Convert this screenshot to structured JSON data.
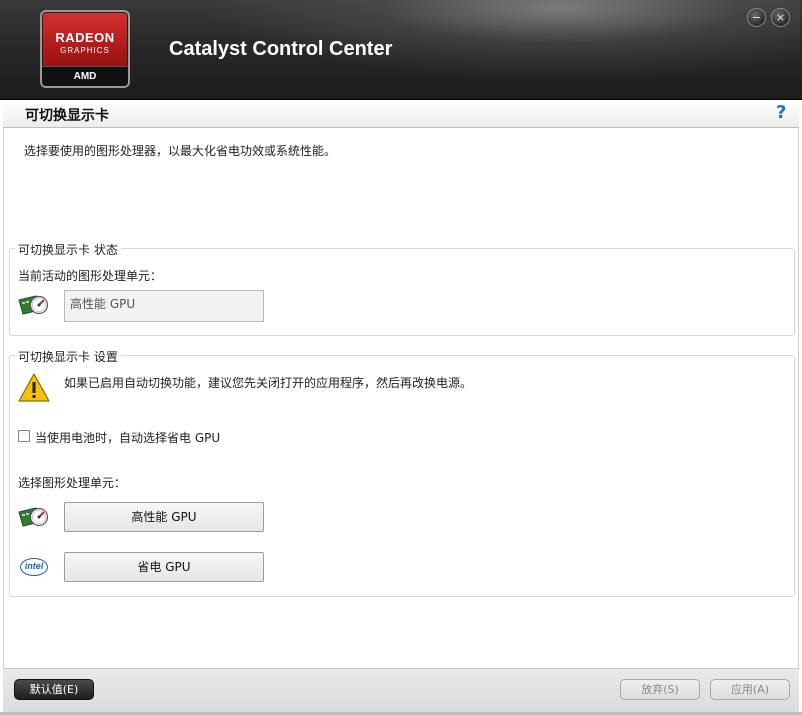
{
  "header": {
    "logo_line1": "RADEON",
    "logo_line2": "GRAPHICS",
    "logo_line3": "AMD",
    "app_title": "Catalyst Control Center",
    "minimize_glyph": "−",
    "close_glyph": "×"
  },
  "page": {
    "title": "可切换显示卡",
    "help_glyph": "?",
    "description": "选择要使用的图形处理器，以最大化省电功效或系统性能。"
  },
  "status_group": {
    "legend": "可切换显示卡 状态",
    "current_label": "当前活动的图形处理单元：",
    "current_value": "高性能 GPU"
  },
  "settings_group": {
    "legend": "可切换显示卡 设置",
    "warning_text": "如果已启用自动切换功能，建议您先关闭打开的应用程序，然后再改换电源。",
    "battery_checkbox_label": "当使用电池时，自动选择省电 GPU",
    "battery_checkbox_checked": false,
    "select_label": "选择图形处理单元：",
    "high_perf_button": "高性能 GPU",
    "power_saving_button": "省电 GPU",
    "intel_icon_text": "intel"
  },
  "footer": {
    "defaults_button": "默认值(E)",
    "discard_button": "放弃(S)",
    "apply_button": "应用(A)"
  },
  "colors": {
    "accent_help": "#2a6db8",
    "logo_red": "#c62828",
    "intel_blue": "#1a64b4"
  }
}
